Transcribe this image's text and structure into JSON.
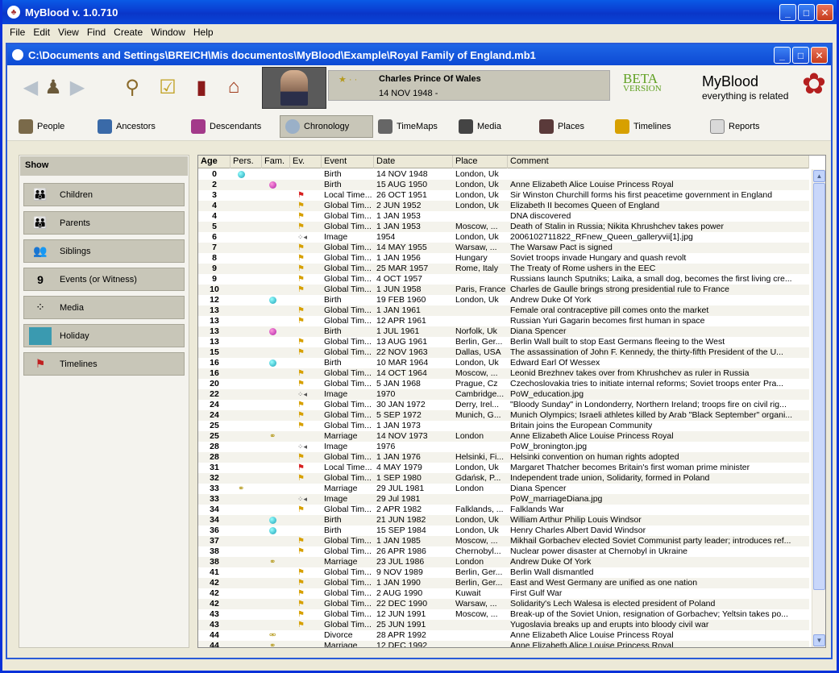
{
  "app": {
    "title": "MyBlood v. 1.0.710",
    "window_buttons": [
      "minimize-icon",
      "maximize-icon",
      "close-icon"
    ]
  },
  "menu": [
    "File",
    "Edit",
    "View",
    "Find",
    "Create",
    "Window",
    "Help"
  ],
  "document": {
    "title": "C:\\Documents and Settings\\BREICH\\Mis documentos\\MyBlood\\Example\\Royal Family of England.mb1"
  },
  "toolbar": {
    "icons": [
      "back-arrow-icon",
      "person-icon",
      "forward-arrow-icon",
      "magnifier-icon",
      "checklist-icon",
      "bookmark-icon",
      "home-icon"
    ],
    "person_name": "Charles Prince Of Wales",
    "person_dates": "14 NOV 1948 -",
    "beta_line1": "BETA",
    "beta_line2": "VERSION",
    "brand_title": "MyBlood",
    "brand_tagline": "everything is related"
  },
  "nav": [
    "People",
    "Ancestors",
    "Descendants",
    "Chronology",
    "TimeMaps",
    "Media",
    "Places",
    "Timelines",
    "Reports"
  ],
  "nav_active": "Chronology",
  "show": {
    "heading": "Show",
    "items": [
      "Children",
      "Parents",
      "Siblings",
      "Events (or Witness)",
      "Media",
      "Holiday",
      "Timelines"
    ]
  },
  "table": {
    "headers": [
      "Age",
      "Pers.",
      "Fam.",
      "Ev.",
      "Event",
      "Date",
      "Place",
      "Comment"
    ],
    "rows": [
      {
        "age": "0",
        "pers": "cyan",
        "fam": "",
        "ev": "",
        "event": "Birth",
        "date": "14 NOV 1948",
        "place": "London, Uk",
        "comment": ""
      },
      {
        "age": "2",
        "pers": "",
        "fam": "pink",
        "ev": "",
        "event": "Birth",
        "date": "15 AUG 1950",
        "place": "London, Uk",
        "comment": "Anne Elizabeth Alice Louise Princess Royal"
      },
      {
        "age": "3",
        "pers": "",
        "fam": "",
        "ev": "flag-r",
        "event": "Local Time...",
        "date": "26 OCT 1951",
        "place": "London, Uk",
        "comment": "Sir Winston Churchill forms his first peacetime government in England"
      },
      {
        "age": "4",
        "pers": "",
        "fam": "",
        "ev": "flag-y",
        "event": "Global Tim...",
        "date": "2 JUN 1952",
        "place": "London, Uk",
        "comment": "Elizabeth II becomes Queen of England"
      },
      {
        "age": "4",
        "pers": "",
        "fam": "",
        "ev": "flag-y",
        "event": "Global Tim...",
        "date": "1 JAN 1953",
        "place": "",
        "comment": "DNA discovered"
      },
      {
        "age": "5",
        "pers": "",
        "fam": "",
        "ev": "flag-y",
        "event": "Global Tim...",
        "date": "1 JAN 1953",
        "place": "Moscow, ...",
        "comment": "Death of Stalin in Russia; Nikita Khrushchev takes power"
      },
      {
        "age": "6",
        "pers": "",
        "fam": "",
        "ev": "cam",
        "event": "Image",
        "date": "1954",
        "place": "London, Uk",
        "comment": "2006102711822_RFnew_Queen_galleryvii[1].jpg"
      },
      {
        "age": "7",
        "pers": "",
        "fam": "",
        "ev": "flag-y",
        "event": "Global Tim...",
        "date": "14 MAY 1955",
        "place": "Warsaw, ...",
        "comment": "The Warsaw Pact is signed"
      },
      {
        "age": "8",
        "pers": "",
        "fam": "",
        "ev": "flag-y",
        "event": "Global Tim...",
        "date": "1 JAN 1956",
        "place": "Hungary",
        "comment": "Soviet troops invade Hungary and quash revolt"
      },
      {
        "age": "9",
        "pers": "",
        "fam": "",
        "ev": "flag-y",
        "event": "Global Tim...",
        "date": "25 MAR 1957",
        "place": "Rome, Italy",
        "comment": "The Treaty of Rome ushers in the EEC"
      },
      {
        "age": "9",
        "pers": "",
        "fam": "",
        "ev": "flag-y",
        "event": "Global Tim...",
        "date": "4 OCT 1957",
        "place": "",
        "comment": "Russians launch Sputniks; Laika, a small dog, becomes the first living cre..."
      },
      {
        "age": "10",
        "pers": "",
        "fam": "",
        "ev": "flag-y",
        "event": "Global Tim...",
        "date": "1 JUN 1958",
        "place": "Paris, France",
        "comment": "Charles de Gaulle brings strong presidential rule to France"
      },
      {
        "age": "12",
        "pers": "",
        "fam": "cyan",
        "ev": "",
        "event": "Birth",
        "date": "19 FEB 1960",
        "place": "London, Uk",
        "comment": "Andrew Duke Of York"
      },
      {
        "age": "13",
        "pers": "",
        "fam": "",
        "ev": "flag-y",
        "event": "Global Tim...",
        "date": "1 JAN 1961",
        "place": "",
        "comment": "Female oral contraceptive pill comes onto the market"
      },
      {
        "age": "13",
        "pers": "",
        "fam": "",
        "ev": "flag-y",
        "event": "Global Tim...",
        "date": "12 APR 1961",
        "place": "",
        "comment": "Russian Yuri Gagarin becomes first human in space"
      },
      {
        "age": "13",
        "pers": "",
        "fam": "pink",
        "ev": "",
        "event": "Birth",
        "date": "1 JUL 1961",
        "place": "Norfolk, Uk",
        "comment": "Diana Spencer"
      },
      {
        "age": "13",
        "pers": "",
        "fam": "",
        "ev": "flag-y",
        "event": "Global Tim...",
        "date": "13 AUG 1961",
        "place": "Berlin, Ger...",
        "comment": "Berlin Wall built to stop East Germans fleeing to the West"
      },
      {
        "age": "15",
        "pers": "",
        "fam": "",
        "ev": "flag-y",
        "event": "Global Tim...",
        "date": "22 NOV 1963",
        "place": "Dallas, USA",
        "comment": "The assassination of John F. Kennedy, the thirty-fifth President of the U..."
      },
      {
        "age": "16",
        "pers": "",
        "fam": "cyan",
        "ev": "",
        "event": "Birth",
        "date": "10 MAR 1964",
        "place": "London, Uk",
        "comment": "Edward Earl Of Wessex"
      },
      {
        "age": "16",
        "pers": "",
        "fam": "",
        "ev": "flag-y",
        "event": "Global Tim...",
        "date": "14 OCT 1964",
        "place": "Moscow, ...",
        "comment": "Leonid Brezhnev takes over from Khrushchev as ruler in Russia"
      },
      {
        "age": "20",
        "pers": "",
        "fam": "",
        "ev": "flag-y",
        "event": "Global Tim...",
        "date": "5 JAN 1968",
        "place": "Prague, Cz",
        "comment": "Czechoslovakia tries to initiate internal reforms; Soviet troops enter Pra..."
      },
      {
        "age": "22",
        "pers": "",
        "fam": "",
        "ev": "cam",
        "event": "Image",
        "date": "1970",
        "place": "Cambridge...",
        "comment": "PoW_education.jpg"
      },
      {
        "age": "24",
        "pers": "",
        "fam": "",
        "ev": "flag-y",
        "event": "Global Tim...",
        "date": "30 JAN 1972",
        "place": "Derry, Irel...",
        "comment": "\"Bloody Sunday\" in Londonderry, Northern Ireland; troops fire on civil rig..."
      },
      {
        "age": "24",
        "pers": "",
        "fam": "",
        "ev": "flag-y",
        "event": "Global Tim...",
        "date": "5 SEP 1972",
        "place": "Munich, G...",
        "comment": "Munich Olympics; Israeli athletes killed by Arab \"Black September\" organi..."
      },
      {
        "age": "25",
        "pers": "",
        "fam": "",
        "ev": "flag-y",
        "event": "Global Tim...",
        "date": "1 JAN 1973",
        "place": "",
        "comment": "Britain joins the European Community"
      },
      {
        "age": "25",
        "pers": "",
        "fam": "ring",
        "ev": "",
        "event": "Marriage",
        "date": "14 NOV 1973",
        "place": "London",
        "comment": "Anne Elizabeth Alice Louise Princess Royal"
      },
      {
        "age": "28",
        "pers": "",
        "fam": "",
        "ev": "cam",
        "event": "Image",
        "date": "1976",
        "place": "",
        "comment": "PoW_bronington.jpg"
      },
      {
        "age": "28",
        "pers": "",
        "fam": "",
        "ev": "flag-y",
        "event": "Global Tim...",
        "date": "1 JAN 1976",
        "place": "Helsinki, Fi...",
        "comment": "Helsinki convention on human rights adopted"
      },
      {
        "age": "31",
        "pers": "",
        "fam": "",
        "ev": "flag-r",
        "event": "Local Time...",
        "date": "4 MAY 1979",
        "place": "London, Uk",
        "comment": "Margaret Thatcher becomes Britain's first woman prime minister"
      },
      {
        "age": "32",
        "pers": "",
        "fam": "",
        "ev": "flag-y",
        "event": "Global Tim...",
        "date": "1 SEP 1980",
        "place": "Gdańsk, P...",
        "comment": "Independent trade union, Solidarity, formed in Poland"
      },
      {
        "age": "33",
        "pers": "ring",
        "fam": "",
        "ev": "",
        "event": "Marriage",
        "date": "29 JUL 1981",
        "place": "London",
        "comment": "Diana Spencer"
      },
      {
        "age": "33",
        "pers": "",
        "fam": "",
        "ev": "cam",
        "event": "Image",
        "date": "29 Jul 1981",
        "place": "",
        "comment": "PoW_marriageDiana.jpg"
      },
      {
        "age": "34",
        "pers": "",
        "fam": "",
        "ev": "flag-y",
        "event": "Global Tim...",
        "date": "2 APR 1982",
        "place": "Falklands, ...",
        "comment": "Falklands War"
      },
      {
        "age": "34",
        "pers": "",
        "fam": "cyan",
        "ev": "",
        "event": "Birth",
        "date": "21 JUN 1982",
        "place": "London, Uk",
        "comment": "William Arthur Philip Louis Windsor"
      },
      {
        "age": "36",
        "pers": "",
        "fam": "cyan",
        "ev": "",
        "event": "Birth",
        "date": "15 SEP 1984",
        "place": "London, Uk",
        "comment": "Henry Charles Albert David Windsor"
      },
      {
        "age": "37",
        "pers": "",
        "fam": "",
        "ev": "flag-y",
        "event": "Global Tim...",
        "date": "1 JAN 1985",
        "place": "Moscow, ...",
        "comment": "Mikhail Gorbachev elected Soviet Communist party leader; introduces ref..."
      },
      {
        "age": "38",
        "pers": "",
        "fam": "",
        "ev": "flag-y",
        "event": "Global Tim...",
        "date": "26 APR 1986",
        "place": "Chernobyl...",
        "comment": "Nuclear power disaster at Chernobyl in Ukraine"
      },
      {
        "age": "38",
        "pers": "",
        "fam": "ring",
        "ev": "",
        "event": "Marriage",
        "date": "23 JUL 1986",
        "place": "London",
        "comment": "Andrew Duke Of York"
      },
      {
        "age": "41",
        "pers": "",
        "fam": "",
        "ev": "flag-y",
        "event": "Global Tim...",
        "date": "9 NOV 1989",
        "place": "Berlin, Ger...",
        "comment": "Berlin Wall dismantled"
      },
      {
        "age": "42",
        "pers": "",
        "fam": "",
        "ev": "flag-y",
        "event": "Global Tim...",
        "date": "1 JAN 1990",
        "place": "Berlin, Ger...",
        "comment": "East and West Germany are unified as one nation"
      },
      {
        "age": "42",
        "pers": "",
        "fam": "",
        "ev": "flag-y",
        "event": "Global Tim...",
        "date": "2 AUG 1990",
        "place": "Kuwait",
        "comment": "First Gulf War"
      },
      {
        "age": "42",
        "pers": "",
        "fam": "",
        "ev": "flag-y",
        "event": "Global Tim...",
        "date": "22 DEC 1990",
        "place": "Warsaw, ...",
        "comment": "Solidarity's Lech Walesa is elected president of Poland"
      },
      {
        "age": "43",
        "pers": "",
        "fam": "",
        "ev": "flag-y",
        "event": "Global Tim...",
        "date": "12 JUN 1991",
        "place": "Moscow, ...",
        "comment": "Break-up of the Soviet Union, resignation of Gorbachev; Yeltsin takes po..."
      },
      {
        "age": "43",
        "pers": "",
        "fam": "",
        "ev": "flag-y",
        "event": "Global Tim...",
        "date": "25 JUN 1991",
        "place": "",
        "comment": "Yugoslavia breaks up and erupts into bloody civil war"
      },
      {
        "age": "44",
        "pers": "",
        "fam": "divorce",
        "ev": "",
        "event": "Divorce",
        "date": "28 APR 1992",
        "place": "",
        "comment": "Anne Elizabeth Alice Louise Princess Royal"
      },
      {
        "age": "44",
        "pers": "",
        "fam": "ring",
        "ev": "",
        "event": "Marriage",
        "date": "12 DEC 1992",
        "place": "",
        "comment": "Anne Elizabeth Alice Louise Princess Royal"
      }
    ]
  },
  "colors": {
    "titlebar": "#0a46d9",
    "panel": "#ece9d8",
    "pers_birth": "#18a0b5",
    "fam_female": "#b01fa6",
    "beta": "#5fa021"
  }
}
